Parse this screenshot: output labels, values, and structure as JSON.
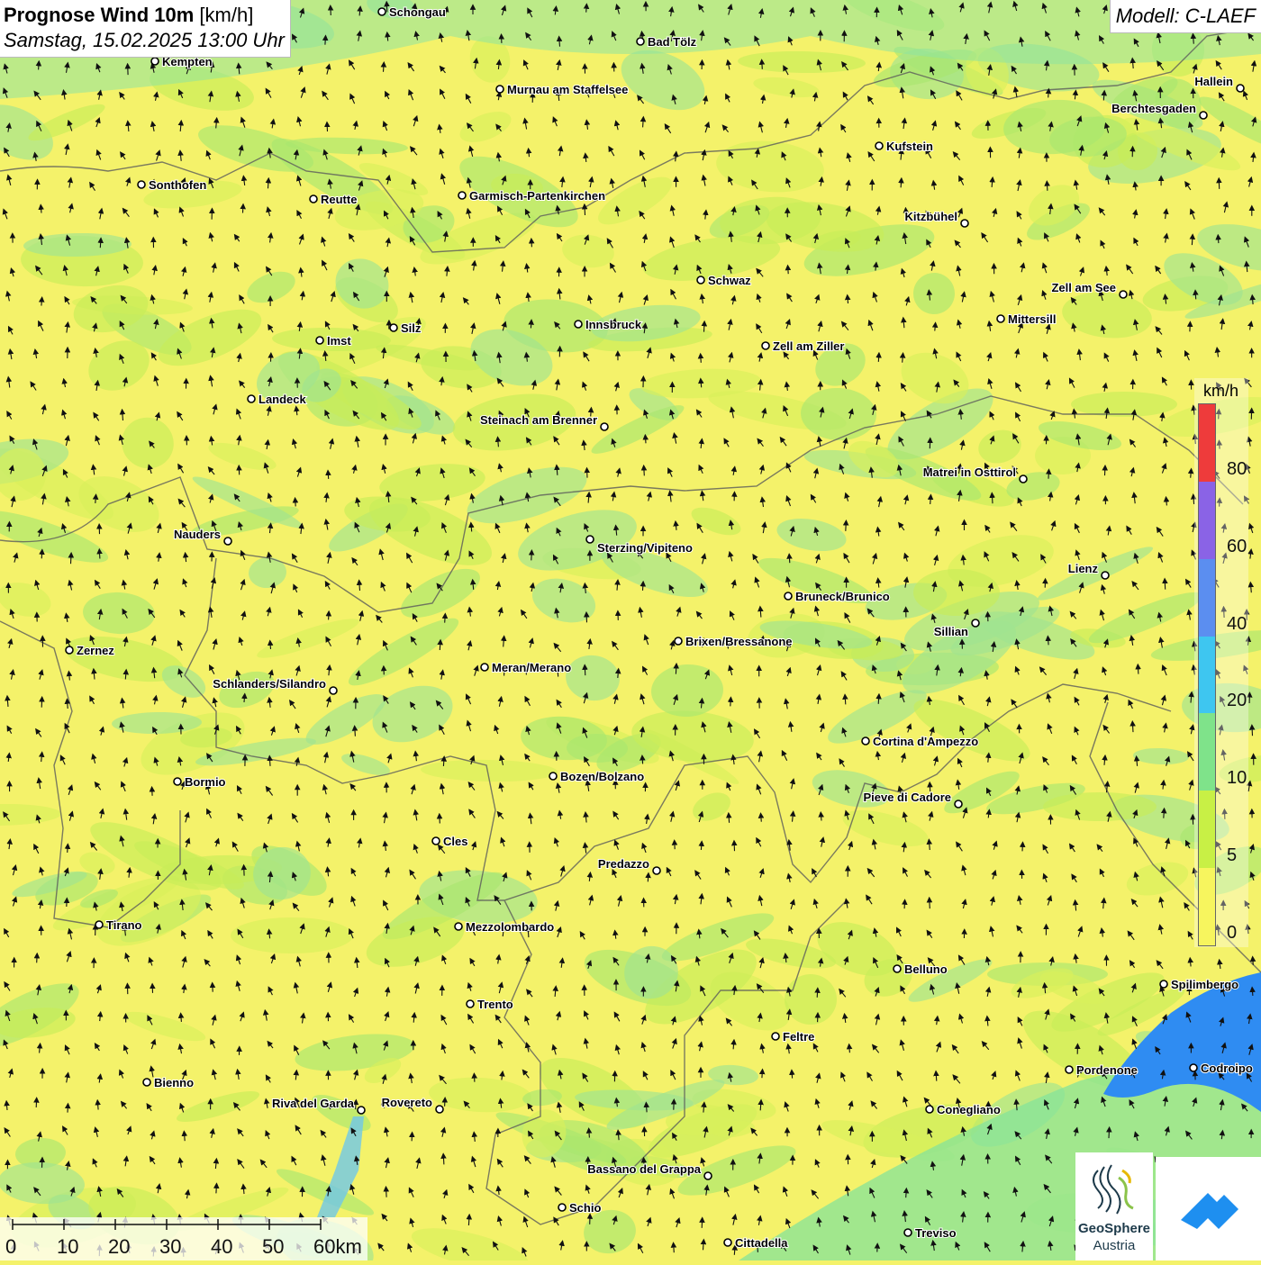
{
  "title": {
    "bold": "Prognose Wind 10m",
    "unit": "[km/h]",
    "datetime": "Samstag, 15.02.2025 13:00 Uhr"
  },
  "model": "Modell: C-LAEF",
  "legend": {
    "unit": "km/h",
    "colors": [
      "#f7f55e",
      "#c8f045",
      "#7fe38a",
      "#3ec6f0",
      "#5b8ef0",
      "#8a63e6",
      "#ee3b3b"
    ],
    "labels": [
      "0",
      "5",
      "10",
      "20",
      "40",
      "60",
      "80"
    ]
  },
  "scale_bar": {
    "labels": [
      "0",
      "10",
      "20",
      "30",
      "40",
      "50",
      "60km"
    ]
  },
  "logos": {
    "geosphere_line1": "GeoSphere",
    "geosphere_line2": "Austria"
  },
  "cities": [
    {
      "name": "Schongau"
    },
    {
      "name": "Bad Tölz"
    },
    {
      "name": "Kempten"
    },
    {
      "name": "Murnau am Staffelsee"
    },
    {
      "name": "Hallein"
    },
    {
      "name": "Berchtesgaden"
    },
    {
      "name": "Kufstein"
    },
    {
      "name": "Sonthofen"
    },
    {
      "name": "Reutte"
    },
    {
      "name": "Garmisch-Partenkirchen"
    },
    {
      "name": "Kitzbühel"
    },
    {
      "name": "Schwaz"
    },
    {
      "name": "Zell am See"
    },
    {
      "name": "Innsbruck"
    },
    {
      "name": "Mittersill"
    },
    {
      "name": "Silz"
    },
    {
      "name": "Imst"
    },
    {
      "name": "Zell am Ziller"
    },
    {
      "name": "Landeck"
    },
    {
      "name": "Steinach am Brenner"
    },
    {
      "name": "Matrei in Osttirol"
    },
    {
      "name": "Nauders"
    },
    {
      "name": "Sterzing/Vipiteno"
    },
    {
      "name": "Lienz"
    },
    {
      "name": "Bruneck/Brunico"
    },
    {
      "name": "Sillian"
    },
    {
      "name": "Brixen/Bressanone"
    },
    {
      "name": "Zernez"
    },
    {
      "name": "Meran/Merano"
    },
    {
      "name": "Schlanders/Silandro"
    },
    {
      "name": "Cortina d'Ampezzo"
    },
    {
      "name": "Bozen/Bolzano"
    },
    {
      "name": "Bormio"
    },
    {
      "name": "Pieve di Cadore"
    },
    {
      "name": "Cles"
    },
    {
      "name": "Predazzo"
    },
    {
      "name": "Tirano"
    },
    {
      "name": "Mezzolombardo"
    },
    {
      "name": "Belluno"
    },
    {
      "name": "Spilimbergo"
    },
    {
      "name": "Trento"
    },
    {
      "name": "Feltre"
    },
    {
      "name": "Pordenone"
    },
    {
      "name": "Codroipo"
    },
    {
      "name": "Bienno"
    },
    {
      "name": "Riva del Garda"
    },
    {
      "name": "Rovereto"
    },
    {
      "name": "Conegliano"
    },
    {
      "name": "Bassano del Grappa"
    },
    {
      "name": "Schio"
    },
    {
      "name": "Treviso"
    },
    {
      "name": "Cittadella"
    }
  ]
}
